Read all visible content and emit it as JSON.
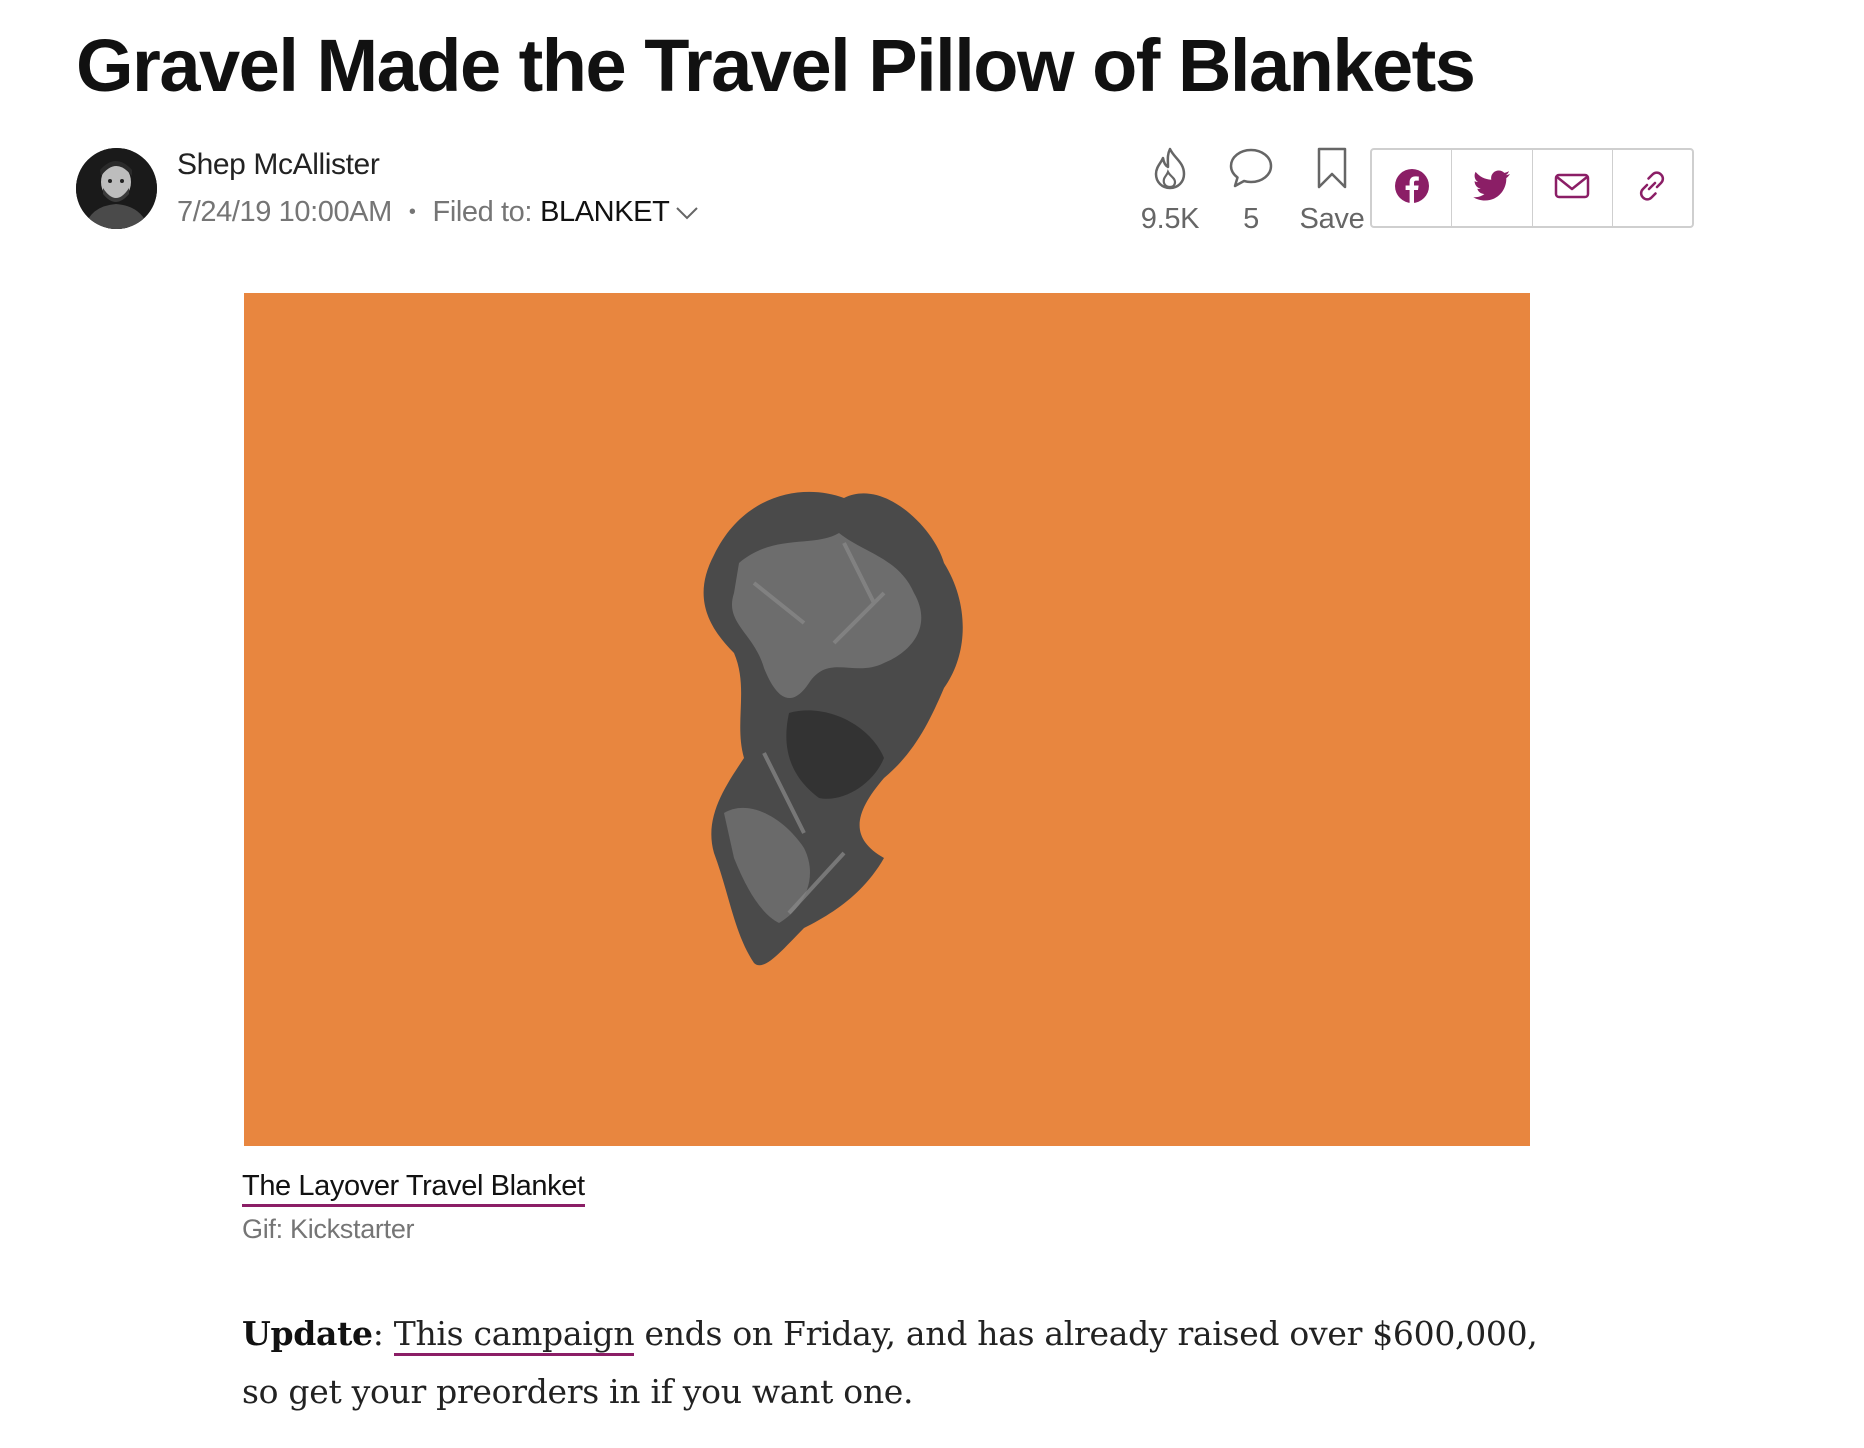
{
  "article": {
    "headline": "Gravel Made the Travel Pillow of Blankets",
    "author": {
      "name": "Shep McAllister",
      "avatar_icon": "author-avatar"
    },
    "timestamp": "7/24/19 10:00AM",
    "separator": "•",
    "filed_label": "Filed to:",
    "filed_tag": "BLANKET"
  },
  "stats": {
    "views": "9.5K",
    "comments": "5",
    "save_label": "Save"
  },
  "share": {
    "icons": [
      "facebook-icon",
      "twitter-icon",
      "email-icon",
      "link-icon"
    ]
  },
  "figure": {
    "caption_title": "The Layover Travel Blanket",
    "caption_credit": "Gif: Kickstarter",
    "background_color": "#e8863f"
  },
  "body": {
    "update_label": "Update",
    "colon": ": ",
    "link_text": "This campaign",
    "text": " ends on Friday, and has already raised over $600,000, so get your preorders in if you want one."
  },
  "colors": {
    "accent": "#8b1e66",
    "meta_gray": "#757575"
  }
}
